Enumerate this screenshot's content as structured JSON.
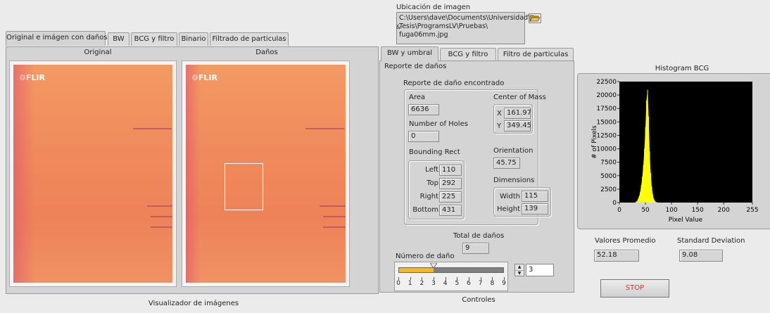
{
  "ubicacion": {
    "label": "Ubicación de imagen",
    "path_line1": "C:\\Users\\dave\\Documents\\Universidad\\",
    "path_line2": "Tesis\\ProgramsLV\\Pruebas\\",
    "path_line3": "fuga06mm.jpg",
    "prefix_glyph": "&",
    "browse_icon": "folder-open-icon"
  },
  "left_tabs": [
    "Original e imágen con daños",
    "BW",
    "BCG y filtro",
    "Binario",
    "Filtrado de particulas"
  ],
  "left_panel": {
    "original_label": "Original",
    "danos_label": "Daños",
    "flir_logo": "FLIR",
    "footer": "Visualizador de imágenes"
  },
  "mid_tabs": [
    "BW y umbral",
    "BCG y filtro",
    "Filtro de particulas"
  ],
  "report": {
    "title": "Reporte de daños",
    "group_title": "Reporte de daño encontrado",
    "area_label": "Area",
    "area_value": "6636",
    "holes_label": "Number of Holes",
    "holes_value": "0",
    "bounding_label": "Bounding Rect",
    "left_label": "Left",
    "left_value": "110",
    "top_label": "Top",
    "top_value": "292",
    "right_label": "Right",
    "right_value": "225",
    "bottom_label": "Bottom",
    "bottom_value": "431",
    "com_label": "Center of Mass",
    "x_label": "X",
    "x_value": "161.97",
    "y_label": "Y",
    "y_value": "349.45",
    "orientation_label": "Orientation",
    "orientation_value": "45.75",
    "dimensions_label": "Dimensions",
    "width_label": "Width",
    "width_value": "115",
    "height_label": "Height",
    "height_value": "139",
    "total_label": "Total de daños",
    "total_value": "9",
    "numero_label": "Número de daño",
    "numero_value": "3",
    "slider_value": 3,
    "slider_ticks": [
      "0",
      "1",
      "2",
      "3",
      "4",
      "5",
      "6",
      "7",
      "8",
      "9"
    ],
    "footer": "Controles"
  },
  "chart_data": {
    "type": "area",
    "title": "Histogram BCG",
    "xlabel": "Pixel Value",
    "ylabel": "# of Pixels",
    "xlim": [
      0,
      255
    ],
    "ylim": [
      0,
      22500
    ],
    "xticks": [
      "0",
      "50",
      "100",
      "150",
      "200",
      "255"
    ],
    "yticks": [
      "0",
      "2500",
      "5000",
      "7500",
      "10000",
      "12500",
      "15000",
      "17500",
      "20000",
      "22500"
    ],
    "x": [
      30,
      34,
      36,
      38,
      40,
      42,
      44,
      46,
      48,
      50,
      52,
      54,
      56,
      58,
      60,
      62,
      64,
      66,
      68,
      70,
      74
    ],
    "values": [
      0,
      300,
      700,
      1200,
      2000,
      3200,
      4800,
      7000,
      10000,
      14000,
      19000,
      21000,
      16000,
      9500,
      5500,
      3000,
      1500,
      700,
      300,
      100,
      0
    ],
    "fill_color": "#ffff00",
    "background": "#000000"
  },
  "stats": {
    "promedio_label": "Valores Promedio",
    "promedio_value": "52.18",
    "std_label": "Standard Deviation",
    "std_value": "9.08"
  },
  "stop_label": "STOP",
  "colors": {
    "stop_text": "#d83030",
    "slider_fill": "#f5b820"
  }
}
